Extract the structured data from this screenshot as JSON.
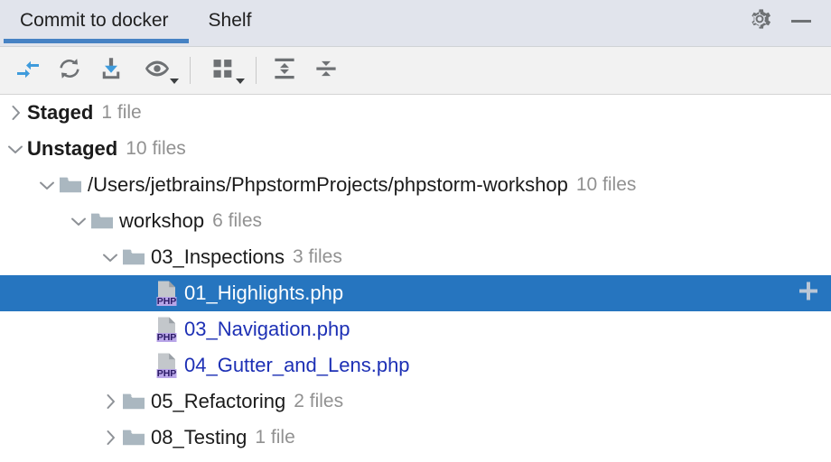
{
  "window": {
    "tabs": [
      {
        "label": "Commit to docker",
        "active": true
      },
      {
        "label": "Shelf",
        "active": false
      }
    ],
    "actions": [
      {
        "name": "settings-gear",
        "label": "Settings"
      },
      {
        "name": "minimize",
        "label": "Minimize"
      }
    ]
  },
  "toolbar": {
    "buttons": [
      {
        "name": "show-diff-icon",
        "label": "Show Diff"
      },
      {
        "name": "refresh-icon",
        "label": "Refresh Changes"
      },
      {
        "name": "revert-icon",
        "label": "Rollback"
      },
      {
        "name": "preview-eye-icon",
        "label": "Preview Diff"
      },
      {
        "name": "group-by-icon",
        "label": "Group By"
      },
      {
        "name": "expand-all-icon",
        "label": "Expand All"
      },
      {
        "name": "collapse-all-icon",
        "label": "Collapse All"
      }
    ]
  },
  "tree": {
    "rows": [
      {
        "id": "staged",
        "kind": "group",
        "indent": 0,
        "chevron": "right",
        "label": "Staged",
        "bold": true,
        "count": "1 file",
        "selected": false
      },
      {
        "id": "unstaged",
        "kind": "group",
        "indent": 0,
        "chevron": "down",
        "label": "Unstaged",
        "bold": true,
        "count": "10 files",
        "selected": false
      },
      {
        "id": "project-root",
        "kind": "folder",
        "indent": 1,
        "chevron": "down",
        "label": "/Users/jetbrains/PhpstormProjects/phpstorm-workshop",
        "bold": false,
        "count": "10 files",
        "selected": false
      },
      {
        "id": "workshop",
        "kind": "folder",
        "indent": 2,
        "chevron": "down",
        "label": "workshop",
        "bold": false,
        "count": "6 files",
        "selected": false
      },
      {
        "id": "03-inspections",
        "kind": "folder",
        "indent": 3,
        "chevron": "down",
        "label": "03_Inspections",
        "bold": false,
        "count": "3 files",
        "selected": false
      },
      {
        "id": "01-highlights",
        "kind": "file",
        "indent": 4,
        "chevron": "none",
        "label": "01_Highlights.php",
        "bold": false,
        "count": "",
        "selected": true,
        "trailing_icon": "plus-icon"
      },
      {
        "id": "03-navigation",
        "kind": "file",
        "indent": 4,
        "chevron": "none",
        "label": "03_Navigation.php",
        "bold": false,
        "count": "",
        "selected": false,
        "modified": true
      },
      {
        "id": "04-gutter-and-lens",
        "kind": "file",
        "indent": 4,
        "chevron": "none",
        "label": "04_Gutter_and_Lens.php",
        "bold": false,
        "count": "",
        "selected": false,
        "modified": true
      },
      {
        "id": "05-refactoring",
        "kind": "folder",
        "indent": 3,
        "chevron": "right",
        "label": "05_Refactoring",
        "bold": false,
        "count": "2 files",
        "selected": false
      },
      {
        "id": "08-testing",
        "kind": "folder",
        "indent": 3,
        "chevron": "right",
        "label": "08_Testing",
        "bold": false,
        "count": "1 file",
        "selected": false
      }
    ]
  },
  "colors": {
    "tabbar_bg": "#e1e4ec",
    "toolbar_bg": "#f2f2f2",
    "accent_blue": "#4682c4",
    "selection_blue": "#2675bf",
    "modified_file": "#1d30b5",
    "count_gray": "#919191",
    "folder_gray": "#aab7c0",
    "php_badge": "#b9a6e8"
  },
  "php_icon_label": "PHP"
}
